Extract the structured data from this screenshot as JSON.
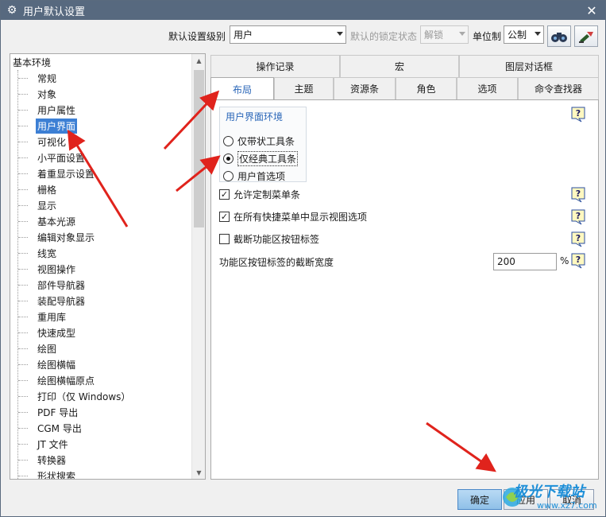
{
  "window": {
    "title": "用户默认设置"
  },
  "toolbar": {
    "level_label": "默认设置级别",
    "level_value": "用户",
    "lock_label": "默认的锁定状态",
    "lock_value": "解锁",
    "unit_label": "单位制",
    "unit_value": "公制"
  },
  "tree": {
    "root": "基本环境",
    "items": [
      "常规",
      "对象",
      "用户属性",
      "用户界面",
      "可视化",
      "小平面设置",
      "着重显示设置",
      "栅格",
      "显示",
      "基本光源",
      "编辑对象显示",
      "线宽",
      "视图操作",
      "部件导航器",
      "装配导航器",
      "重用库",
      "快速成型",
      "绘图",
      "绘图横幅",
      "绘图横幅原点",
      "打印（仅 Windows）",
      "PDF 导出",
      "CGM 导出",
      "JT 文件",
      "转换器",
      "形状搜索"
    ],
    "selected": "用户界面"
  },
  "tabs": {
    "row1": [
      "操作记录",
      "宏",
      "图层对话框"
    ],
    "row2": [
      "布局",
      "主题",
      "资源条",
      "角色",
      "选项",
      "命令查找器"
    ],
    "active": "布局"
  },
  "panel": {
    "group_title": "用户界面环境",
    "radios": [
      {
        "label": "仅带状工具条",
        "checked": false
      },
      {
        "label": "仅经典工具条",
        "checked": true
      },
      {
        "label": "用户首选项",
        "checked": false
      }
    ],
    "checkboxes": [
      {
        "label": "允许定制菜单条",
        "checked": true
      },
      {
        "label": "在所有快捷菜单中显示视图选项",
        "checked": true
      },
      {
        "label": "截断功能区按钮标签",
        "checked": false
      }
    ],
    "truncate_width_label": "功能区按钮标签的截断宽度",
    "truncate_width_value": "200",
    "truncate_width_unit": "%"
  },
  "buttons": {
    "ok": "确定",
    "apply": "应用",
    "cancel": "取消"
  },
  "watermark": {
    "text": "极光下载站",
    "sub": "www.xz7.com"
  },
  "colors": {
    "titlebar": "#57697f",
    "selection": "#3c7fd4",
    "tab_active_text": "#2966b8",
    "annotation_arrow": "#e0231c"
  }
}
